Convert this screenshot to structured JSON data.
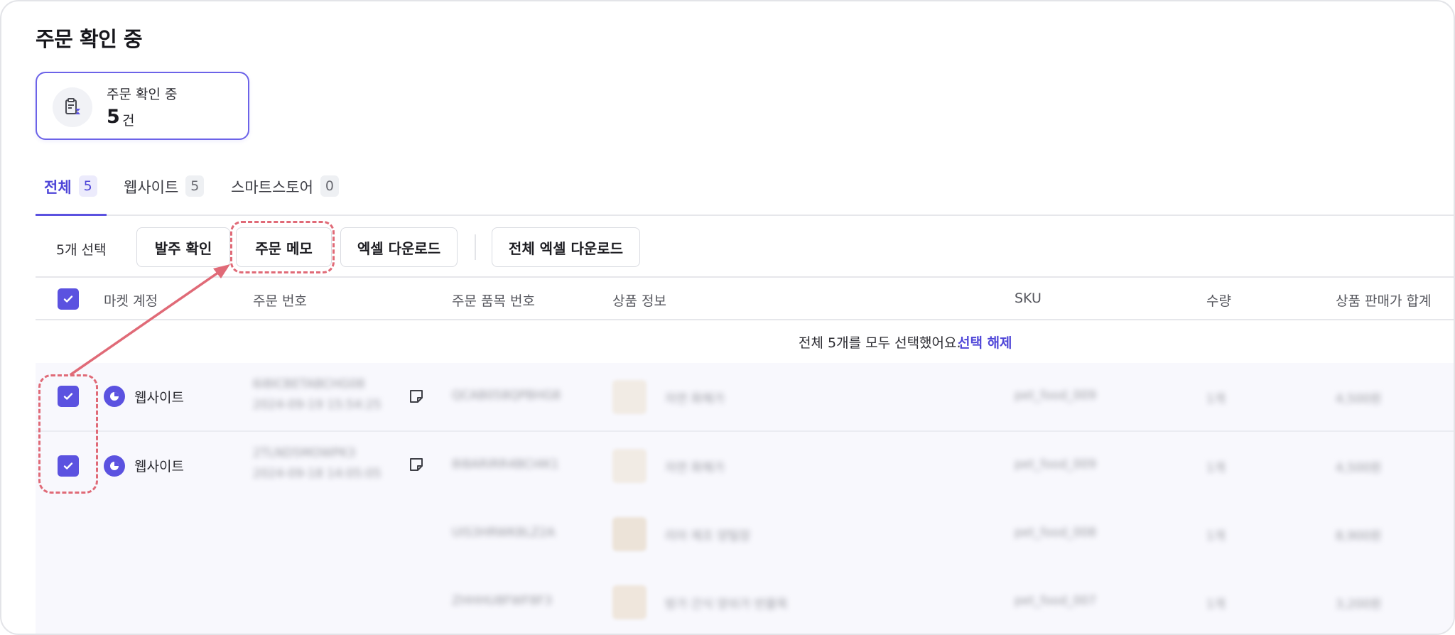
{
  "page": {
    "title": "주문 확인 중"
  },
  "summary": {
    "label": "주문 확인 중",
    "count": "5",
    "unit": "건",
    "icon": "clipboard-hourglass-icon"
  },
  "tabs": [
    {
      "label": "전체",
      "count": "5",
      "active": true
    },
    {
      "label": "웹사이트",
      "count": "5",
      "active": false
    },
    {
      "label": "스마트스토어",
      "count": "0",
      "active": false
    }
  ],
  "toolbar": {
    "selected_label": "5개 선택",
    "confirm_label": "발주 확인",
    "memo_label": "주문 메모",
    "excel_label": "엑셀 다운로드",
    "excel_all_label": "전체 엑셀 다운로드"
  },
  "table": {
    "headers": [
      "마켓 계정",
      "주문 번호",
      "주문 품목 번호",
      "상품 정보",
      "SKU",
      "수량",
      "상품 판매가 합계"
    ],
    "notice": "전체 5개를 모두 선택했어요.",
    "notice_link": "선택 해제",
    "rows": [
      {
        "market": "웹사이트",
        "order_no": "6I8ICBETABCHG08",
        "order_time": "2024-09-19 15:54:25",
        "items": [
          {
            "item_no": "QCAB058QPBHG8",
            "product": "자연 화해가",
            "sku": "pet_food_009",
            "qty": "1개",
            "price": "4,500원"
          }
        ]
      },
      {
        "market": "웹사이트",
        "order_no": "2TLND5MOWPK3",
        "order_time": "2024-09-18 14:05:05",
        "items": [
          {
            "item_no": "8I8ARIRR4BCI4K1",
            "product": "자연 화해가",
            "sku": "pet_food_009",
            "qty": "1개",
            "price": "4,500원"
          },
          {
            "item_no": "UIS3HRWK8LZ2A",
            "product": "리아 제조 양털장",
            "sku": "pet_food_008",
            "qty": "1개",
            "price": "8,900원"
          },
          {
            "item_no": "ZHHHU8FWF8F3",
            "product": "방가 간식 양쉬가 반물목",
            "sku": "pet_food_007",
            "qty": "1개",
            "price": "3,200원"
          }
        ]
      }
    ]
  },
  "colors": {
    "accent": "#5b52e0",
    "highlight": "#e06a77",
    "row_bg": "#f8f8fd"
  }
}
